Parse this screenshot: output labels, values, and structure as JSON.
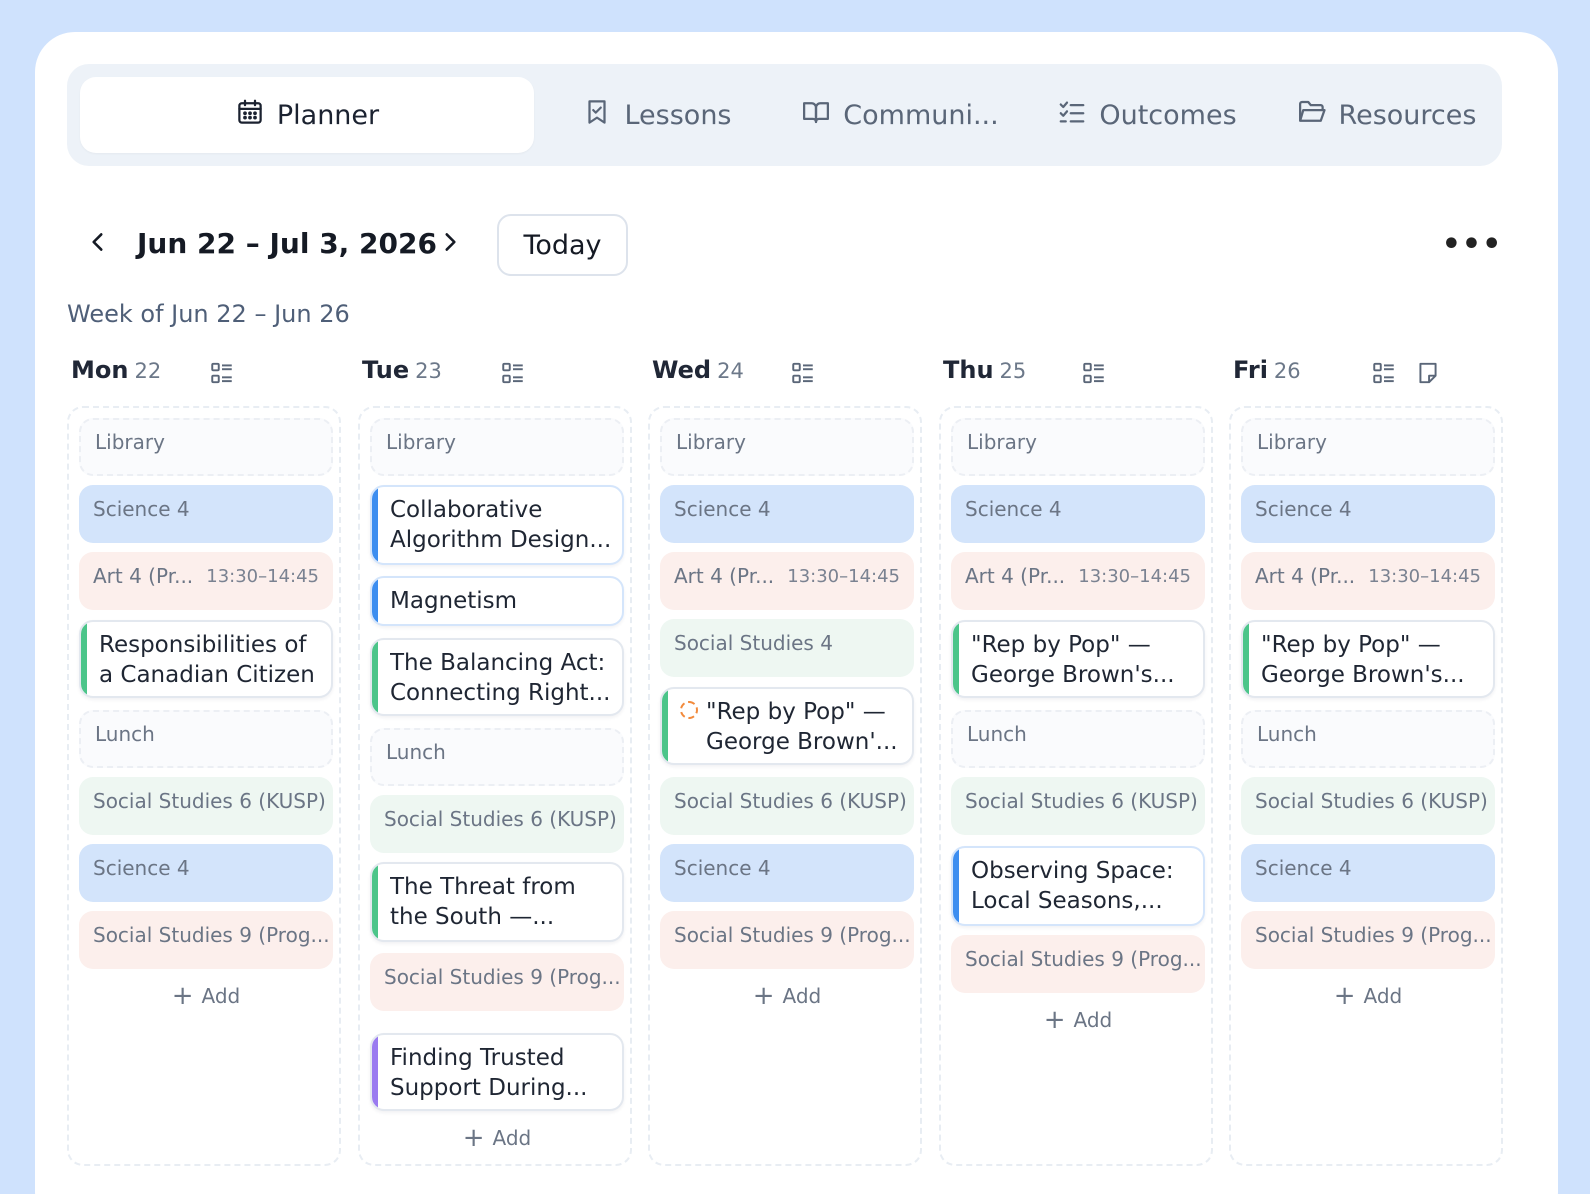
{
  "tabs": [
    {
      "label": "Planner",
      "icon": "calendar-icon",
      "active": true
    },
    {
      "label": "Lessons",
      "icon": "bookmark-icon"
    },
    {
      "label": "Communi...",
      "icon": "book-open-icon"
    },
    {
      "label": "Outcomes",
      "icon": "checklist-icon"
    },
    {
      "label": "Resources",
      "icon": "folder-icon"
    }
  ],
  "toolbar": {
    "range": "Jun 22 – Jul 3, 2026",
    "today": "Today",
    "more": "•••"
  },
  "week_label": "Week of Jun 22 – Jun 26",
  "days": [
    {
      "name": "Mon",
      "num": "22",
      "slots": {
        "library": "Library",
        "science1": "Science 4",
        "art": "Art 4 (Pr...",
        "art_time": "13:30–14:45",
        "lesson1": [
          "Responsibilities of",
          "a Canadian Citizen"
        ],
        "lunch": "Lunch",
        "soc6": "Social Studies 6 (KUSP)",
        "science2": "Science 4",
        "soc9": "Social Studies 9 (Prog..."
      },
      "add": "Add"
    },
    {
      "name": "Tue",
      "num": "23",
      "slots": {
        "library": "Library",
        "lesson1": [
          "Collaborative",
          "Algorithm Design..."
        ],
        "lesson2": [
          "Magnetism"
        ],
        "lesson3": [
          "The Balancing Act:",
          "Connecting Right..."
        ],
        "lunch": "Lunch",
        "soc6": "Social Studies 6 (KUSP)",
        "lesson4": [
          "The Threat from",
          "the South —..."
        ],
        "soc9": "Social Studies 9 (Prog...",
        "lesson5": [
          "Finding Trusted",
          "Support During..."
        ]
      },
      "add": "Add"
    },
    {
      "name": "Wed",
      "num": "24",
      "slots": {
        "library": "Library",
        "science1": "Science 4",
        "art": "Art 4 (Pr...",
        "art_time": "13:30–14:45",
        "soc4": "Social Studies 4",
        "lesson1": [
          "\"Rep by Pop\" —",
          "George Brown'..."
        ],
        "soc6": "Social Studies 6 (KUSP)",
        "science2": "Science 4",
        "soc9": "Social Studies 9 (Prog..."
      },
      "add": "Add"
    },
    {
      "name": "Thu",
      "num": "25",
      "slots": {
        "library": "Library",
        "science1": "Science 4",
        "art": "Art 4 (Pr...",
        "art_time": "13:30–14:45",
        "lesson1": [
          "\"Rep by Pop\" —",
          "George Brown's..."
        ],
        "lunch": "Lunch",
        "soc6": "Social Studies 6 (KUSP)",
        "lesson2": [
          "Observing Space:",
          "Local Seasons,..."
        ],
        "soc9": "Social Studies 9 (Prog..."
      },
      "add": "Add"
    },
    {
      "name": "Fri",
      "num": "26",
      "slots": {
        "library": "Library",
        "science1": "Science 4",
        "art": "Art 4 (Pr...",
        "art_time": "13:30–14:45",
        "lesson1": [
          "\"Rep by Pop\" —",
          "George Brown's..."
        ],
        "lunch": "Lunch",
        "soc6": "Social Studies 6 (KUSP)",
        "science2": "Science 4",
        "soc9": "Social Studies 9 (Prog..."
      },
      "add": "Add"
    }
  ],
  "colors": {
    "background": "#cfe2fd",
    "science": "#d3e4fb",
    "art": "#fcefec",
    "social_studies": "#eef7f2",
    "accent_green": "#4cc58a",
    "accent_blue": "#3d8ef0",
    "accent_purple": "#9a7bf0"
  }
}
